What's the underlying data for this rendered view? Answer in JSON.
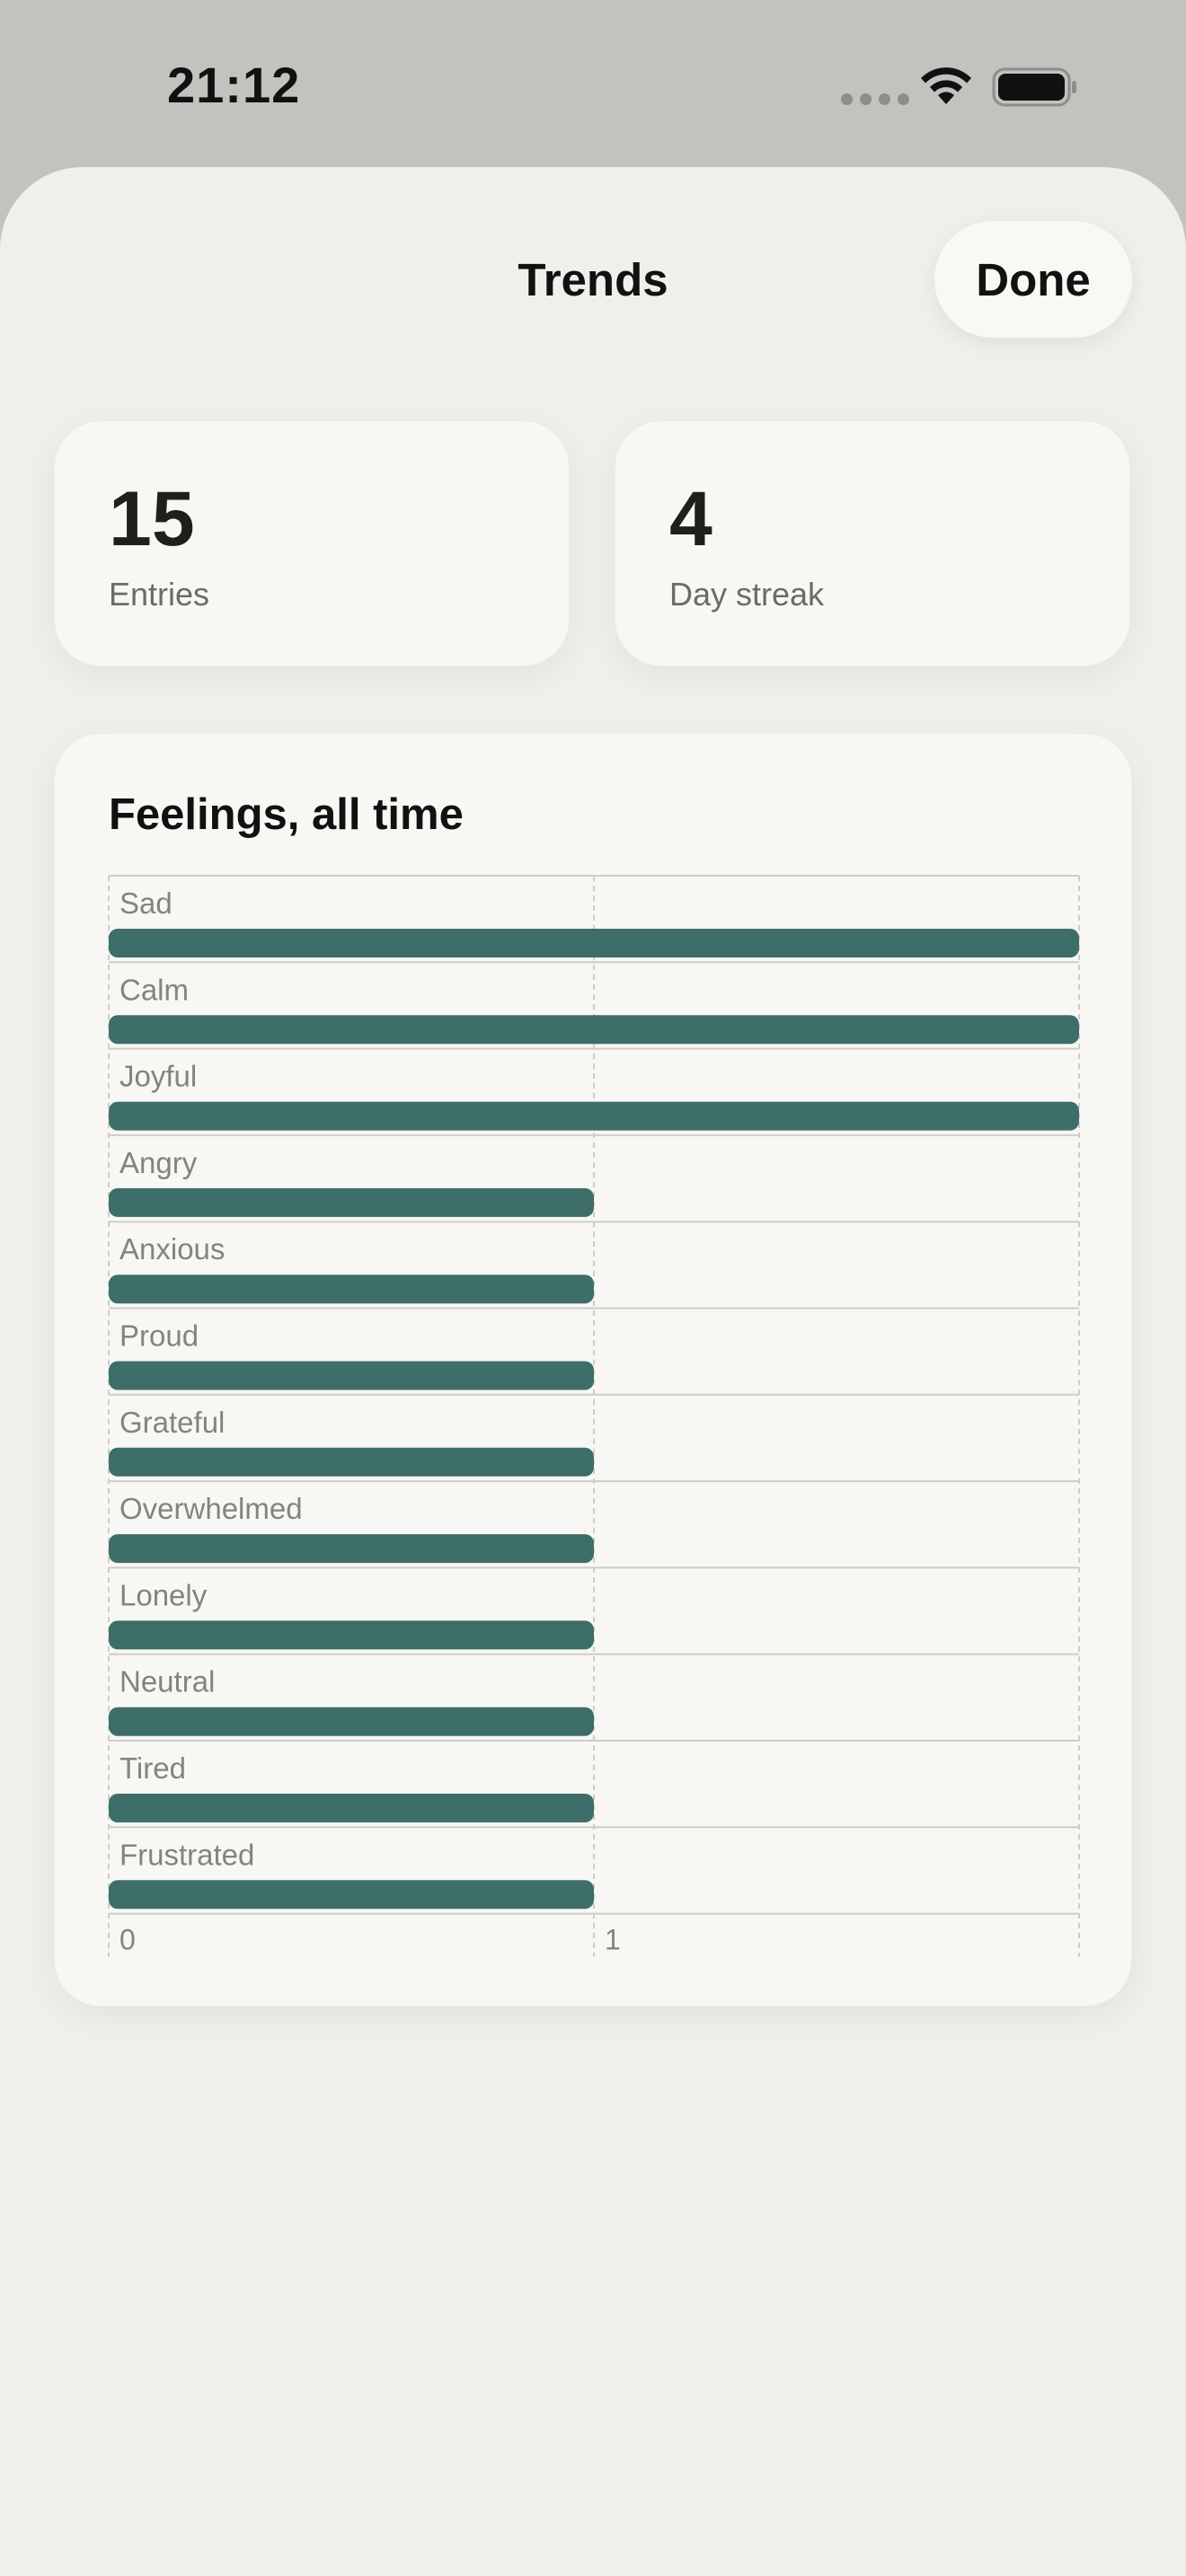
{
  "status_bar": {
    "time": "21:12"
  },
  "nav": {
    "title": "Trends",
    "done_label": "Done"
  },
  "stats": [
    {
      "value": "15",
      "label": "Entries"
    },
    {
      "value": "4",
      "label": "Day streak"
    }
  ],
  "chart_title": "Feelings, all time",
  "colors": {
    "bar": "#3d6e69",
    "gridline": "#cfcdc8",
    "label": "#85837f"
  },
  "chart_data": {
    "type": "bar",
    "orientation": "horizontal",
    "title": "Feelings, all time",
    "categories": [
      "Sad",
      "Calm",
      "Joyful",
      "Angry",
      "Anxious",
      "Proud",
      "Grateful",
      "Overwhelmed",
      "Lonely",
      "Neutral",
      "Tired",
      "Frustrated"
    ],
    "values": [
      2,
      2,
      2,
      1,
      1,
      1,
      1,
      1,
      1,
      1,
      1,
      1
    ],
    "xlim": [
      0,
      2
    ],
    "x_ticks": [
      "0",
      "1"
    ],
    "grid": true
  }
}
